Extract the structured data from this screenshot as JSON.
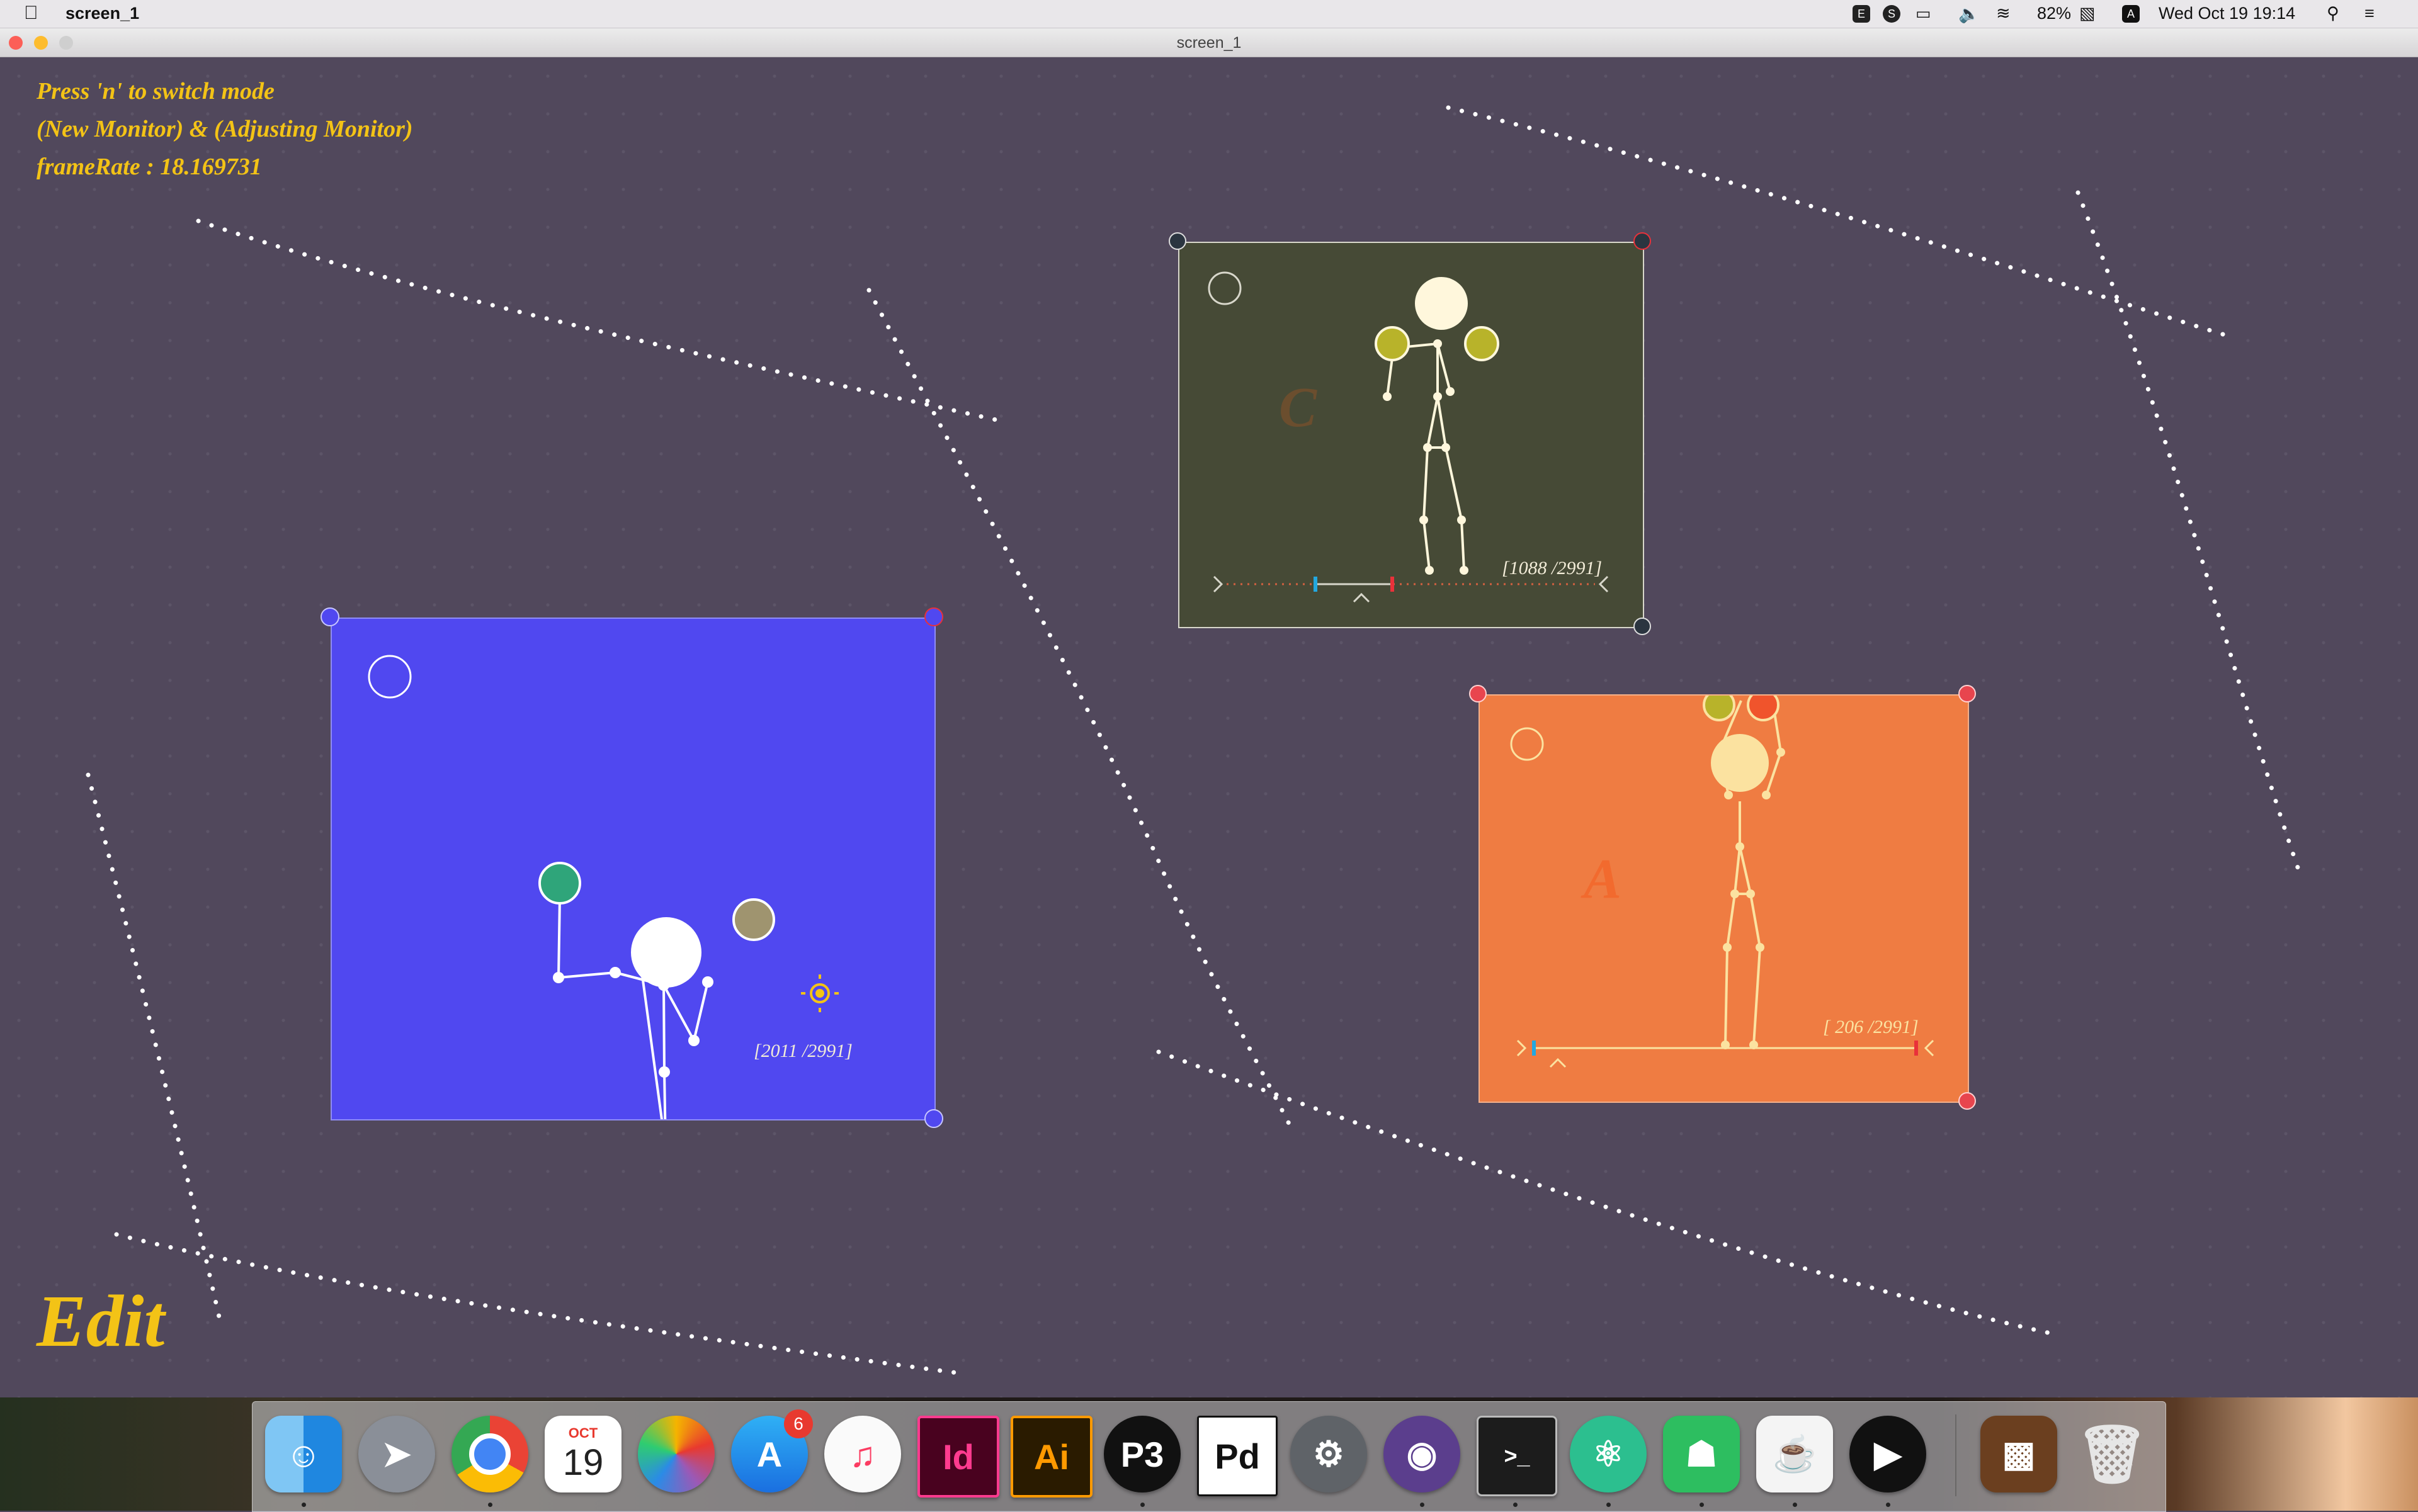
{
  "menubar": {
    "app_name": "screen_1",
    "battery": "82%",
    "input_source": "A",
    "clock": "Wed Oct 19  19:14"
  },
  "window": {
    "title": "screen_1"
  },
  "hud": {
    "line1": "Press 'n' to switch mode",
    "line2": "(New Monitor) & (Adjusting Monitor)",
    "line3": "frameRate : 18.169731"
  },
  "mode_label": "Edit",
  "monitors": {
    "blue": {
      "frame": "[2011 /2991]",
      "color": "#5048f0"
    },
    "green": {
      "frame": "[1088 /2991]",
      "letter": "C",
      "color": "#464a36"
    },
    "orange": {
      "frame": "[ 206 /2991]",
      "letter": "A",
      "color": "#ef7c42"
    }
  },
  "dock": {
    "calendar_month": "OCT",
    "calendar_day": "19",
    "appstore_badge": "6",
    "indesign": "Id",
    "illustrator": "Ai",
    "processing": "P3",
    "puredata": "Pd"
  },
  "colors": {
    "accent": "#f3c316",
    "background": "#51485c"
  }
}
